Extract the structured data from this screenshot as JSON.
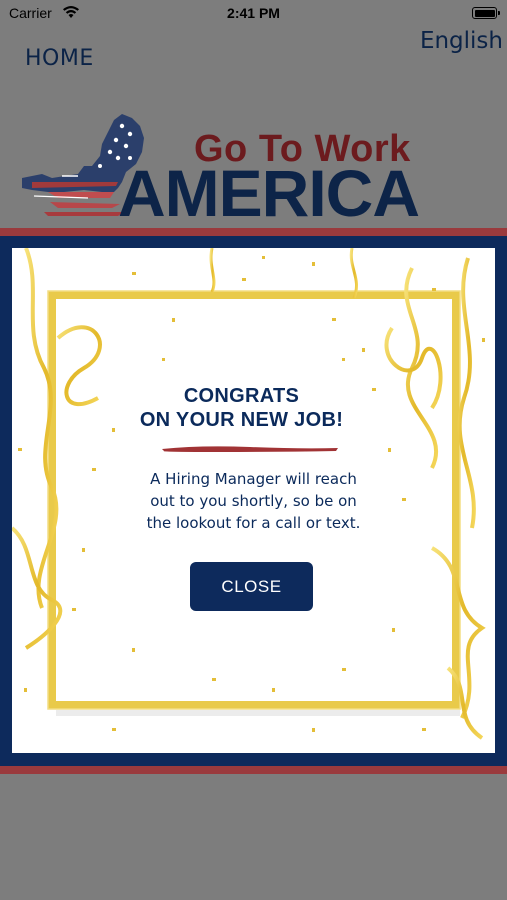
{
  "status_bar": {
    "carrier": "Carrier",
    "time": "2:41 PM"
  },
  "nav": {
    "home": "HOME",
    "language": "English"
  },
  "logo": {
    "line1": "Go To Work",
    "line2": "AMERICA"
  },
  "modal": {
    "title_line1": "CONGRATS",
    "title_line2": "ON YOUR NEW JOB!",
    "message_line1": "A Hiring Manager will reach",
    "message_line2": "out to you shortly, so be on",
    "message_line3": "the lookout for a call or text.",
    "close_label": "CLOSE"
  },
  "colors": {
    "overlay": "#7d7d7d",
    "navy": "#0d2a5c",
    "red": "#9a3a3d",
    "gold": "#e8c53a"
  }
}
